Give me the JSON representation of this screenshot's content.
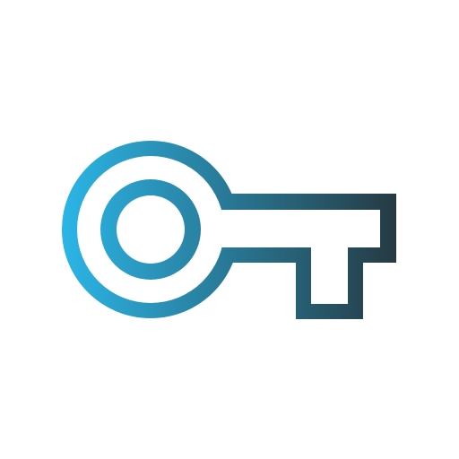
{
  "icon": {
    "name": "key-icon",
    "colors": {
      "gradient_start": "#2bb5e6",
      "gradient_end": "#263a43",
      "background": "#ffffff"
    }
  }
}
